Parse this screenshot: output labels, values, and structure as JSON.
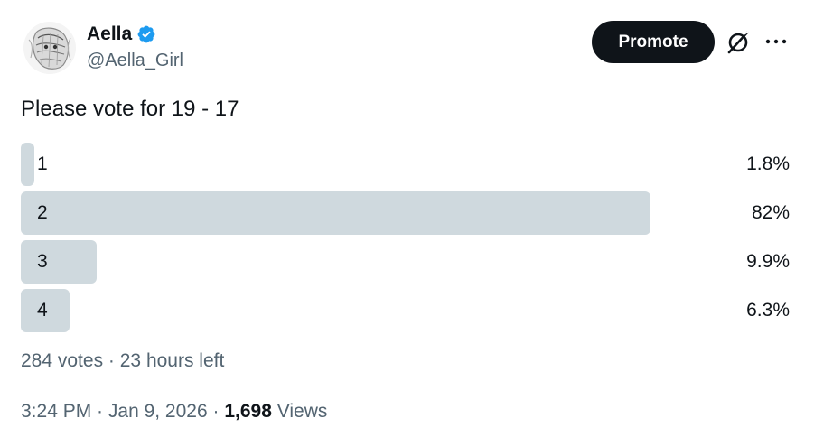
{
  "author": {
    "name": "Aella",
    "handle": "@Aella_Girl",
    "verified": true,
    "verified_color": "#1d9bf0",
    "avatar_icon": "avatar-sketch-icon"
  },
  "header": {
    "promote_label": "Promote",
    "grok_icon": "grok-icon",
    "more_icon": "more-icon"
  },
  "tweet": {
    "text": "Please vote for 19 - 17"
  },
  "poll": {
    "bar_color": "#cfd9de",
    "options": [
      {
        "label": "1",
        "percent_text": "1.8%",
        "percent": 1.8
      },
      {
        "label": "2",
        "percent_text": "82%",
        "percent": 82
      },
      {
        "label": "3",
        "percent_text": "9.9%",
        "percent": 9.9
      },
      {
        "label": "4",
        "percent_text": "6.3%",
        "percent": 6.3
      }
    ],
    "votes": "284 votes",
    "separator": " · ",
    "time_left": "23 hours left"
  },
  "meta": {
    "time": "3:24 PM",
    "separator": " · ",
    "date": "Jan 9, 2026",
    "views_count": "1,698",
    "views_label": "Views"
  }
}
